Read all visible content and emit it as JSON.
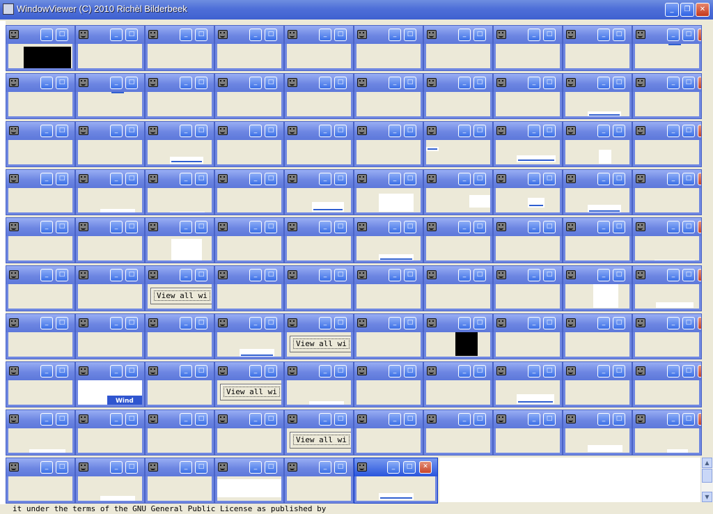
{
  "window": {
    "title": "WindowViewer (C) 2010 Richèl Bilderbeek",
    "minimize_glyph": "_",
    "restore_glyph": "❐",
    "close_glyph": "✕"
  },
  "grid": {
    "rows": 10,
    "cols": 10,
    "last_row_count": 6,
    "child_icon": "smiley-icon",
    "close_buttons": [
      [
        0,
        9
      ],
      [
        1,
        9
      ],
      [
        2,
        9
      ],
      [
        3,
        9
      ],
      [
        4,
        9
      ],
      [
        5,
        9
      ],
      [
        6,
        9
      ],
      [
        7,
        9
      ],
      [
        8,
        9
      ],
      [
        9,
        5
      ]
    ],
    "view_all_label": "View all wi",
    "embedded_window_text": "Wind"
  },
  "status_text": "it under the terms of the GNU General Public License as published by",
  "colors": {
    "titlebar": "#4E6FD8",
    "child_titlebar": "#6D86E2",
    "surface": "#ECE9D8",
    "close_button": "#C4381D"
  }
}
